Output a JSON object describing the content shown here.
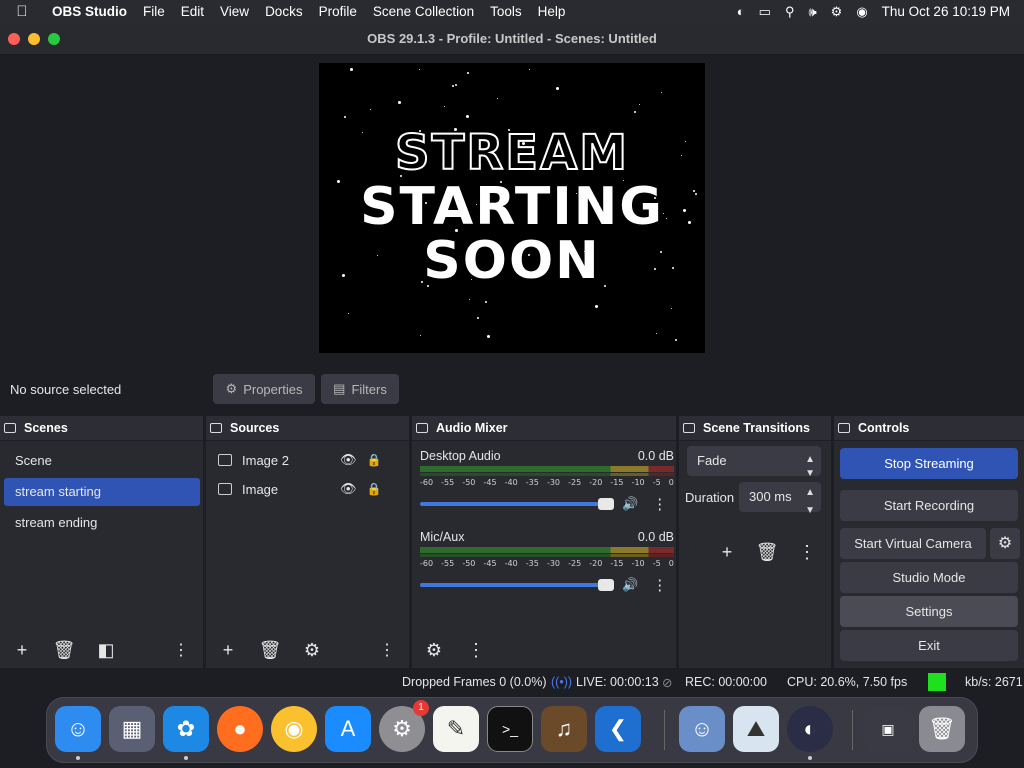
{
  "menubar": {
    "app_name": "OBS Studio",
    "items": [
      "File",
      "Edit",
      "View",
      "Docks",
      "Profile",
      "Scene Collection",
      "Tools",
      "Help"
    ],
    "clock": "Thu Oct 26  10:19 PM"
  },
  "window": {
    "title": "OBS 29.1.3 - Profile: Untitled - Scenes: Untitled"
  },
  "preview": {
    "line1": "STREAM",
    "line2": "STARTING",
    "line3": "SOON"
  },
  "context": {
    "no_source": "No source selected",
    "properties": "Properties",
    "filters": "Filters"
  },
  "scenes": {
    "title": "Scenes",
    "items": [
      "Scene",
      "stream starting",
      "stream ending"
    ],
    "selected_index": 1
  },
  "sources": {
    "title": "Sources",
    "items": [
      "Image 2",
      "Image"
    ]
  },
  "mixer": {
    "title": "Audio Mixer",
    "channels": [
      {
        "name": "Desktop Audio",
        "db": "0.0 dB"
      },
      {
        "name": "Mic/Aux",
        "db": "0.0 dB"
      }
    ],
    "ticks": [
      "-60",
      "-55",
      "-50",
      "-45",
      "-40",
      "-35",
      "-30",
      "-25",
      "-20",
      "-15",
      "-10",
      "-5",
      "0"
    ]
  },
  "transitions": {
    "title": "Scene Transitions",
    "selected": "Fade",
    "duration_label": "Duration",
    "duration_value": "300 ms"
  },
  "controls": {
    "title": "Controls",
    "stop_streaming": "Stop Streaming",
    "start_recording": "Start Recording",
    "start_virtual_camera": "Start Virtual Camera",
    "studio_mode": "Studio Mode",
    "settings": "Settings",
    "exit": "Exit"
  },
  "status": {
    "dropped_frames": "Dropped Frames 0 (0.0%)",
    "live": "LIVE: 00:00:13",
    "rec": "REC: 00:00:00",
    "cpu": "CPU: 20.6%, 7.50 fps",
    "kbs": "kb/s: 2671"
  },
  "dock_badge": "1",
  "colors": {
    "accent": "#2f54b3",
    "panel": "#292a30",
    "background": "#1d1e24",
    "status_ok": "#1fe01f"
  }
}
